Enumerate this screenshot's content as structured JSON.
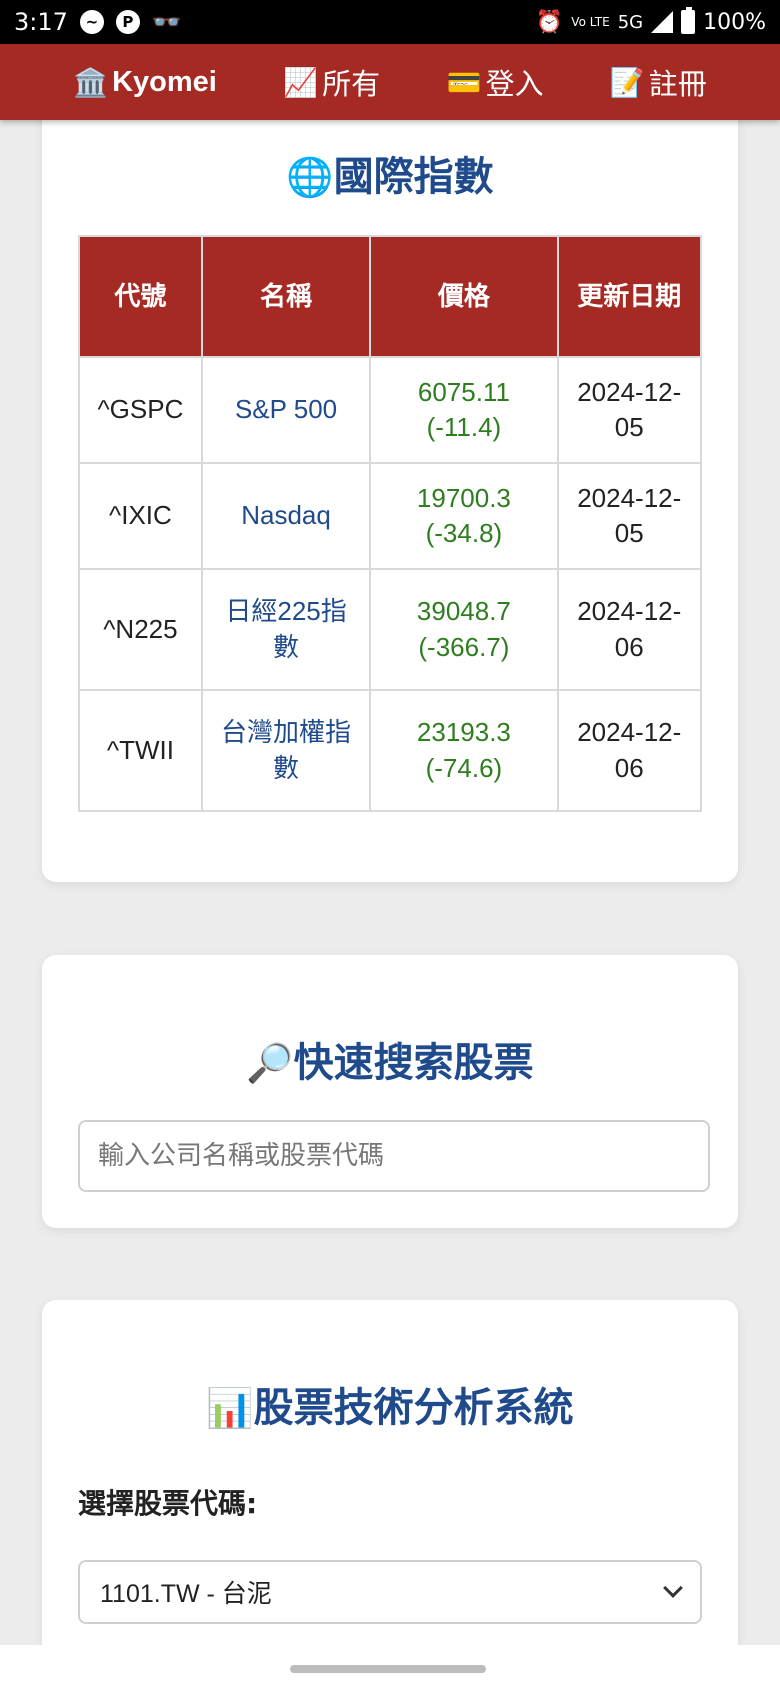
{
  "status_bar": {
    "time": "3:17",
    "network": "5G",
    "volte": "Vo LTE",
    "battery": "100%"
  },
  "navbar": {
    "brand": "Kyomei",
    "brand_icon": "🏛️",
    "items": [
      {
        "icon": "📈",
        "label": "所有"
      },
      {
        "icon": "💳",
        "label": "登入"
      },
      {
        "icon": "📝",
        "label": "註冊"
      }
    ]
  },
  "indices": {
    "title_icon": "🌐",
    "title": "國際指數",
    "headers": [
      "代號",
      "名稱",
      "價格",
      "更新日期"
    ],
    "rows": [
      {
        "symbol": "^GSPC",
        "name": "S&P 500",
        "price": "6075.11 (-11.4)",
        "date": "2024-12-05"
      },
      {
        "symbol": "^IXIC",
        "name": "Nasdaq",
        "price": "19700.3 (-34.8)",
        "date": "2024-12-05"
      },
      {
        "symbol": "^N225",
        "name": "日經225指數",
        "price": "39048.7 (-366.7)",
        "date": "2024-12-06"
      },
      {
        "symbol": "^TWII",
        "name": "台灣加權指數",
        "price": "23193.3 (-74.6)",
        "date": "2024-12-06"
      }
    ]
  },
  "search": {
    "title_icon": "🔎",
    "title": "快速搜索股票",
    "placeholder": "輸入公司名稱或股票代碼"
  },
  "analysis": {
    "title_icon": "📊",
    "title": "股票技術分析系統",
    "select_label": "選擇股票代碼:",
    "selected": "1101.TW - 台泥"
  },
  "colors": {
    "primary_red": "#a52a24",
    "title_blue": "#1f4a8c",
    "price_green": "#2e7d1e"
  }
}
